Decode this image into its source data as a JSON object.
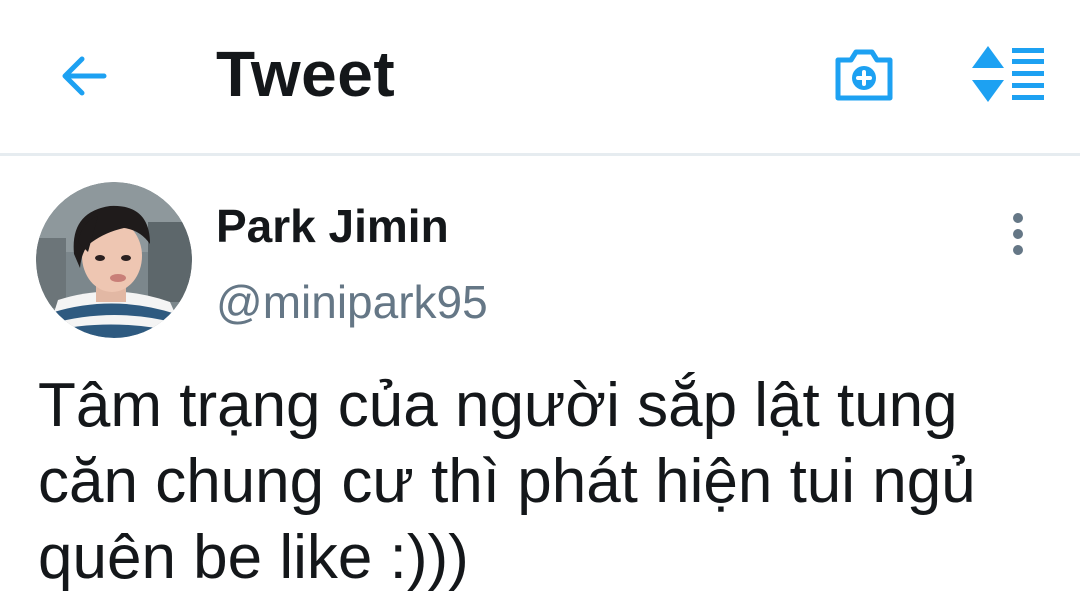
{
  "header": {
    "title": "Tweet",
    "back_icon": "arrow-left-icon",
    "camera_icon": "camera-add-icon",
    "sort_icon": "sort-lines-icon",
    "accent_color": "#1da1f2"
  },
  "tweet": {
    "author": {
      "display_name": "Park Jimin",
      "handle": "@minipark95"
    },
    "text": "Tâm trạng của người sắp lật tung căn chung cư thì phát hiện tui ngủ quên be like :)))",
    "more_icon": "more-vertical-icon"
  }
}
